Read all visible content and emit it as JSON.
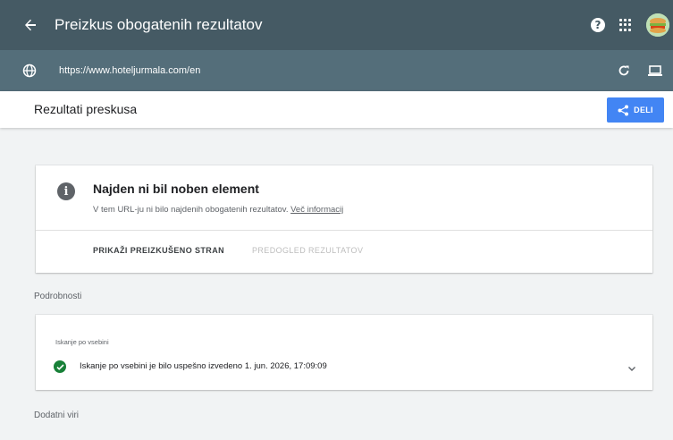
{
  "appbar": {
    "title": "Preizkus obogatenih rezultatov"
  },
  "urlbar": {
    "url": "https://www.hoteljurmala.com/en"
  },
  "toolbar": {
    "title": "Rezultati preskusa",
    "share_label": "DELI"
  },
  "result_card": {
    "title": "Najden ni bil noben element",
    "description": "V tem URL-ju ni bilo najdenih obogatenih rezultatov.",
    "more_link": "Več informacij",
    "tab_tested_page": "PRIKAŽI PREIZKUŠENO STRAN",
    "tab_preview": "PREDOGLED REZULTATOV"
  },
  "details": {
    "label": "Podrobnosti",
    "crawl_card": {
      "subtitle": "Iskanje po vsebini",
      "status_text": "Iskanje po vsebini je bilo uspešno izvedeno 1. jun. 2026, 17:09:09"
    }
  },
  "extra_label": "Dodatni viri",
  "colors": {
    "appbar": "#455a64",
    "urlbar": "#546e7a",
    "accent": "#4285f4",
    "success": "#188038"
  },
  "icons": [
    "back-arrow-icon",
    "help-icon",
    "apps-grid-icon",
    "avatar",
    "globe-icon",
    "refresh-icon",
    "desktop-icon",
    "share-icon",
    "info-icon",
    "check-circle-icon",
    "chevron-down-icon"
  ]
}
